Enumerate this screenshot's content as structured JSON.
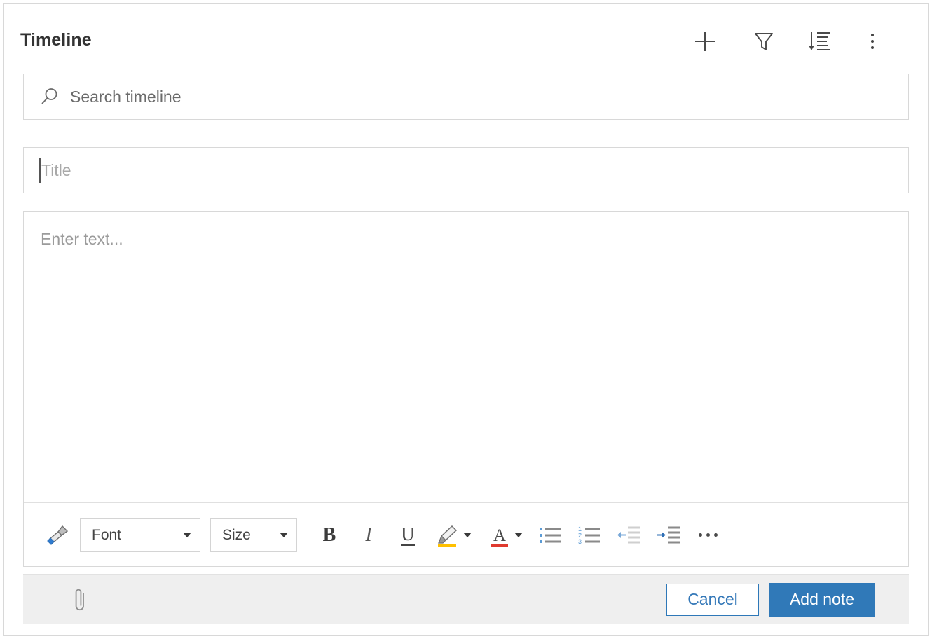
{
  "panel": {
    "title": "Timeline"
  },
  "header_actions": [
    {
      "name": "add-icon",
      "label": "Add"
    },
    {
      "name": "filter-icon",
      "label": "Filter"
    },
    {
      "name": "sort-icon",
      "label": "Sort"
    },
    {
      "name": "more-options-icon",
      "label": "More options"
    }
  ],
  "search": {
    "icon": "search-icon",
    "placeholder": "Search timeline",
    "value": ""
  },
  "note_form": {
    "title_field": {
      "placeholder": "Title",
      "value": "",
      "caret_visible": true
    },
    "body_field": {
      "placeholder": "Enter text...",
      "value": ""
    }
  },
  "format_toolbar": {
    "format_painter": {
      "icon": "format-painter-icon",
      "label": "Format painter"
    },
    "font_select": {
      "label": "Font",
      "caret": "chevron-down-icon"
    },
    "size_select": {
      "label": "Size",
      "caret": "chevron-down-icon"
    },
    "bold": {
      "glyph": "B",
      "label": "Bold"
    },
    "italic": {
      "glyph": "I",
      "label": "Italic"
    },
    "underline": {
      "glyph": "U",
      "label": "Underline"
    },
    "highlight": {
      "icon": "highlight-icon",
      "label": "Text highlight color",
      "color": "#ffc000"
    },
    "font_color": {
      "icon": "font-color-icon",
      "label": "Font color",
      "color": "#e03a2f"
    },
    "bulleted_list": {
      "icon": "bulleted-list-icon",
      "label": "Bulleted list"
    },
    "numbered_list": {
      "icon": "numbered-list-icon",
      "label": "Numbered list"
    },
    "decrease_indent": {
      "icon": "decrease-indent-icon",
      "label": "Decrease indent",
      "disabled": true
    },
    "increase_indent": {
      "icon": "increase-indent-icon",
      "label": "Increase indent",
      "disabled": false
    },
    "more": {
      "icon": "more-formatting-icon",
      "label": "More formatting options"
    }
  },
  "footer": {
    "attach": {
      "icon": "paperclip-icon",
      "label": "Attach file"
    },
    "cancel_label": "Cancel",
    "submit_label": "Add note"
  },
  "colors": {
    "accent_blue": "#3079b8",
    "panel_border": "#d8d8d8",
    "footer_bg": "#efefef",
    "placeholder_text": "#9b9b9b",
    "title_text": "#333333",
    "highlight_yellow": "#ffc000",
    "font_color_red": "#e03a2f",
    "list_icon_blue": "#5b9bd5"
  }
}
